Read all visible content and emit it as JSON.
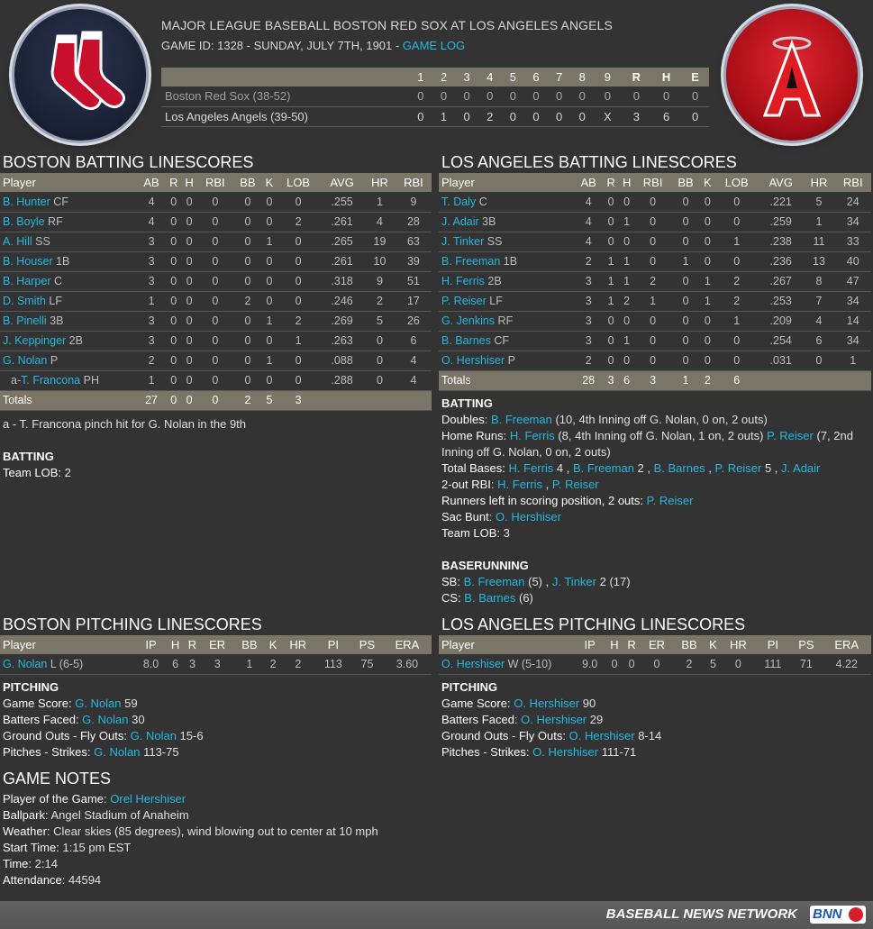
{
  "header": {
    "title": "MAJOR LEAGUE BASEBALL BOSTON RED SOX AT LOS ANGELES ANGELS",
    "game_line": "GAME ID: 1328 - SUNDAY, JULY 7TH, 1901 - ",
    "game_log_link": "GAME LOG",
    "away_logo": "red-sox-logo",
    "home_logo": "angels-logo"
  },
  "linescore": {
    "columns": [
      "1",
      "2",
      "3",
      "4",
      "5",
      "6",
      "7",
      "8",
      "9",
      "R",
      "H",
      "E"
    ],
    "rows": [
      {
        "team": "Boston Red Sox (38-52)",
        "cells": [
          "0",
          "0",
          "0",
          "0",
          "0",
          "0",
          "0",
          "0",
          "0",
          "0",
          "0",
          "0"
        ]
      },
      {
        "team": "Los Angeles Angels (39-50)",
        "cells": [
          "0",
          "1",
          "0",
          "2",
          "0",
          "0",
          "0",
          "0",
          "X",
          "3",
          "6",
          "0"
        ]
      }
    ]
  },
  "boston_batting": {
    "title": "BOSTON BATTING LINESCORES",
    "columns": [
      "Player",
      "AB",
      "R",
      "H",
      "RBI",
      "BB",
      "K",
      "LOB",
      "AVG",
      "HR",
      "RBI"
    ],
    "rows": [
      {
        "name": "B. Hunter",
        "pos": "CF",
        "cells": [
          "4",
          "0",
          "0",
          "0",
          "0",
          "0",
          "0",
          ".255",
          "1",
          "9"
        ]
      },
      {
        "name": "B. Boyle",
        "pos": "RF",
        "cells": [
          "4",
          "0",
          "0",
          "0",
          "0",
          "0",
          "2",
          ".261",
          "4",
          "28"
        ]
      },
      {
        "name": "A. Hill",
        "pos": "SS",
        "cells": [
          "3",
          "0",
          "0",
          "0",
          "0",
          "1",
          "0",
          ".265",
          "19",
          "63"
        ]
      },
      {
        "name": "B. Houser",
        "pos": "1B",
        "cells": [
          "3",
          "0",
          "0",
          "0",
          "0",
          "0",
          "0",
          ".261",
          "10",
          "39"
        ]
      },
      {
        "name": "B. Harper",
        "pos": "C",
        "cells": [
          "3",
          "0",
          "0",
          "0",
          "0",
          "0",
          "0",
          ".318",
          "9",
          "51"
        ]
      },
      {
        "name": "D. Smith",
        "pos": "LF",
        "cells": [
          "1",
          "0",
          "0",
          "0",
          "2",
          "0",
          "0",
          ".246",
          "2",
          "17"
        ]
      },
      {
        "name": "B. Pinelli",
        "pos": "3B",
        "cells": [
          "3",
          "0",
          "0",
          "0",
          "0",
          "1",
          "2",
          ".269",
          "5",
          "26"
        ]
      },
      {
        "name": "J. Keppinger",
        "pos": "2B",
        "cells": [
          "3",
          "0",
          "0",
          "0",
          "0",
          "0",
          "1",
          ".263",
          "0",
          "6"
        ]
      },
      {
        "name": "G. Nolan",
        "pos": "P",
        "cells": [
          "2",
          "0",
          "0",
          "0",
          "0",
          "1",
          "0",
          ".088",
          "0",
          "4"
        ]
      },
      {
        "prefix": "a-",
        "name": "T. Francona",
        "pos": "PH",
        "cells": [
          "1",
          "0",
          "0",
          "0",
          "0",
          "0",
          "0",
          ".288",
          "0",
          "4"
        ]
      }
    ],
    "totals_label": "Totals",
    "totals": [
      "27",
      "0",
      "0",
      "0",
      "2",
      "5",
      "3",
      "",
      "",
      ""
    ],
    "note": "a - T. Francona pinch hit for G. Nolan in the 9th",
    "batting_header": "BATTING",
    "team_lob_label": "Team LOB:",
    "team_lob_value": "2"
  },
  "la_batting": {
    "title": "LOS ANGELES BATTING LINESCORES",
    "columns": [
      "Player",
      "AB",
      "R",
      "H",
      "RBI",
      "BB",
      "K",
      "LOB",
      "AVG",
      "HR",
      "RBI"
    ],
    "rows": [
      {
        "name": "T. Daly",
        "pos": "C",
        "cells": [
          "4",
          "0",
          "0",
          "0",
          "0",
          "0",
          "0",
          ".221",
          "5",
          "24"
        ]
      },
      {
        "name": "J. Adair",
        "pos": "3B",
        "cells": [
          "4",
          "0",
          "1",
          "0",
          "0",
          "0",
          "0",
          ".259",
          "1",
          "34"
        ]
      },
      {
        "name": "J. Tinker",
        "pos": "SS",
        "cells": [
          "4",
          "0",
          "0",
          "0",
          "0",
          "0",
          "1",
          ".238",
          "11",
          "33"
        ]
      },
      {
        "name": "B. Freeman",
        "pos": "1B",
        "cells": [
          "2",
          "1",
          "1",
          "0",
          "1",
          "0",
          "0",
          ".236",
          "13",
          "40"
        ]
      },
      {
        "name": "H. Ferris",
        "pos": "2B",
        "cells": [
          "3",
          "1",
          "1",
          "2",
          "0",
          "1",
          "2",
          ".267",
          "8",
          "47"
        ]
      },
      {
        "name": "P. Reiser",
        "pos": "LF",
        "cells": [
          "3",
          "1",
          "2",
          "1",
          "0",
          "1",
          "2",
          ".253",
          "7",
          "34"
        ]
      },
      {
        "name": "G. Jenkins",
        "pos": "RF",
        "cells": [
          "3",
          "0",
          "0",
          "0",
          "0",
          "0",
          "1",
          ".209",
          "4",
          "14"
        ]
      },
      {
        "name": "B. Barnes",
        "pos": "CF",
        "cells": [
          "3",
          "0",
          "1",
          "0",
          "0",
          "0",
          "0",
          ".254",
          "6",
          "34"
        ]
      },
      {
        "name": "O. Hershiser",
        "pos": "P",
        "cells": [
          "2",
          "0",
          "0",
          "0",
          "0",
          "0",
          "0",
          ".031",
          "0",
          "1"
        ]
      }
    ],
    "totals_label": "Totals",
    "totals": [
      "28",
      "3",
      "6",
      "3",
      "1",
      "2",
      "6",
      "",
      "",
      ""
    ],
    "batting_header": "BATTING",
    "doubles_label": "Doubles:",
    "doubles_player": "B. Freeman",
    "doubles_detail": " (10, 4th Inning off G. Nolan, 0 on, 2 outs)",
    "hr_label": "Home Runs:",
    "hr_player1": "H. Ferris",
    "hr_detail1": " (8, 4th Inning off G. Nolan, 1 on, 2 outs) ",
    "hr_player2": "P. Reiser",
    "hr_detail2": " (7, 2nd Inning off G. Nolan, 0 on, 2 outs)",
    "tb_label": "Total Bases:",
    "tb_p1": "H. Ferris",
    "tb_v1": " 4 , ",
    "tb_p2": "B. Freeman",
    "tb_v2": " 2 , ",
    "tb_p3": "B. Barnes",
    "tb_v3": " , ",
    "tb_p4": "P. Reiser",
    "tb_v4": " 5 , ",
    "tb_p5": "J. Adair",
    "rbi2_label": "2-out RBI:",
    "rbi2_p1": "H. Ferris",
    "rbi2_sep": " , ",
    "rbi2_p2": "P. Reiser",
    "risp_label": "Runners left in scoring position, 2 outs:",
    "risp_p": "P. Reiser",
    "sac_label": "Sac Bunt:",
    "sac_p": "O. Hershiser",
    "team_lob_label": "Team LOB:",
    "team_lob_value": "3",
    "baserunning_header": "BASERUNNING",
    "sb_label": "SB:",
    "sb_p1": "B. Freeman",
    "sb_v1": " (5) , ",
    "sb_p2": "J. Tinker",
    "sb_v2": " 2 (17)",
    "cs_label": "CS:",
    "cs_p": "B. Barnes",
    "cs_v": " (6)"
  },
  "boston_pitching": {
    "title": "BOSTON PITCHING LINESCORES",
    "columns": [
      "Player",
      "IP",
      "H",
      "R",
      "ER",
      "BB",
      "K",
      "HR",
      "PI",
      "PS",
      "ERA"
    ],
    "rows": [
      {
        "name": "G. Nolan",
        "pos": "L (6-5)",
        "cells": [
          "8.0",
          "6",
          "3",
          "3",
          "1",
          "2",
          "2",
          "113",
          "75",
          "3.60"
        ]
      }
    ],
    "pitching_header": "PITCHING",
    "game_score_label": "Game Score:",
    "game_score_p": "G. Nolan",
    "game_score_v": " 59",
    "bf_label": "Batters Faced:",
    "bf_p": "G. Nolan",
    "bf_v": " 30",
    "go_label": "Ground Outs - Fly Outs:",
    "go_p": "G. Nolan",
    "go_v": " 15-6",
    "ps_label": "Pitches - Strikes:",
    "ps_p": "G. Nolan",
    "ps_v": " 113-75"
  },
  "la_pitching": {
    "title": "LOS ANGELES PITCHING LINESCORES",
    "columns": [
      "Player",
      "IP",
      "H",
      "R",
      "ER",
      "BB",
      "K",
      "HR",
      "PI",
      "PS",
      "ERA"
    ],
    "rows": [
      {
        "name": "O. Hershiser",
        "pos": "W (5-10)",
        "cells": [
          "9.0",
          "0",
          "0",
          "0",
          "2",
          "5",
          "0",
          "111",
          "71",
          "4.22"
        ]
      }
    ],
    "pitching_header": "PITCHING",
    "game_score_label": "Game Score:",
    "game_score_p": "O. Hershiser",
    "game_score_v": " 90",
    "bf_label": "Batters Faced:",
    "bf_p": "O. Hershiser",
    "bf_v": " 29",
    "go_label": "Ground Outs - Fly Outs:",
    "go_p": "O. Hershiser",
    "go_v": " 8-14",
    "ps_label": "Pitches - Strikes:",
    "ps_p": "O. Hershiser",
    "ps_v": " 111-71"
  },
  "game_notes": {
    "title": "GAME NOTES",
    "potg_label": "Player of the Game:",
    "potg_value": "Orel Hershiser",
    "ballpark_label": "Ballpark:",
    "ballpark_value": "Angel Stadium of Anaheim",
    "weather_label": "Weather:",
    "weather_value": "Clear skies (85 degrees), wind blowing out to center at 10 mph",
    "start_label": "Start Time:",
    "start_value": "1:15 pm EST",
    "time_label": "Time:",
    "time_value": "2:14",
    "att_label": "Attendance:",
    "att_value": "44594"
  },
  "footer": {
    "brand": "BASEBALL NEWS NETWORK",
    "badge": "BNN"
  }
}
